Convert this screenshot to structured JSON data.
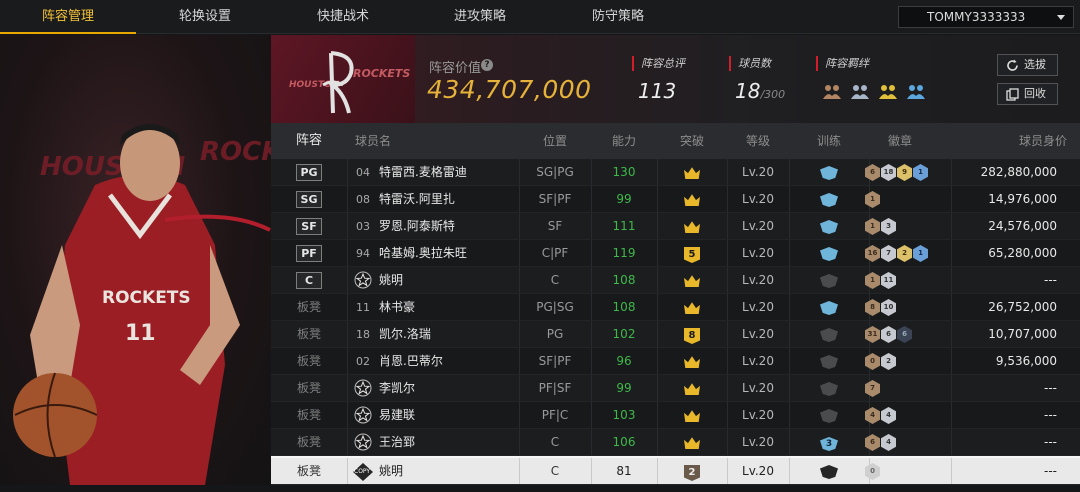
{
  "nav": {
    "tabs": [
      "阵容管理",
      "轮换设置",
      "快捷战术",
      "进攻策略",
      "防守策略"
    ],
    "active_tab": 0,
    "user": "TOMMY3333333"
  },
  "team": {
    "logo_text_left": "HOUSTON",
    "logo_text_right": "ROCKETS",
    "art_text_left": "HOUSTON",
    "art_text_right": "ROCK",
    "jersey_team": "ROCKETS",
    "jersey_number": "11",
    "value_label": "阵容价值",
    "value": "434,707,000",
    "rating_label": "阵容总评",
    "rating": "113",
    "players_label": "球员数",
    "players": "18",
    "players_max": "/300",
    "chem_label": "阵容羁绊",
    "btn_pick": "选拔",
    "btn_recycle": "回收"
  },
  "columns": [
    "阵容",
    "球员名",
    "位置",
    "能力",
    "突破",
    "等级",
    "训练",
    "徽章",
    "球员身价"
  ],
  "colors": {
    "accent_gold": "#e7b23a",
    "ability_green": "#3fb84a",
    "label_red": "#d21e2b"
  },
  "rows": [
    {
      "slot": "PG",
      "starter": true,
      "num": "04",
      "name": "特雷西.麦格雷迪",
      "pos": "SG|PG",
      "ability": "130",
      "break": "crown",
      "level": "Lv.20",
      "train": "blue",
      "badges": [
        [
          "bronze",
          "6"
        ],
        [
          "silver",
          "18"
        ],
        [
          "gold",
          "9"
        ],
        [
          "blue",
          "1"
        ]
      ],
      "value": "282,880,000"
    },
    {
      "slot": "SG",
      "starter": true,
      "num": "08",
      "name": "特雷沃.阿里扎",
      "pos": "SF|PF",
      "ability": "99",
      "break": "crown",
      "level": "Lv.20",
      "train": "blue",
      "badges": [
        [
          "bronze",
          "1"
        ]
      ],
      "value": "14,976,000"
    },
    {
      "slot": "SF",
      "starter": true,
      "num": "03",
      "name": "罗恩.阿泰斯特",
      "pos": "SF",
      "ability": "111",
      "break": "crown",
      "level": "Lv.20",
      "train": "blue",
      "badges": [
        [
          "bronze",
          "1"
        ],
        [
          "silver",
          "3"
        ]
      ],
      "value": "24,576,000"
    },
    {
      "slot": "PF",
      "starter": true,
      "num": "94",
      "name": "哈基姆.奥拉朱旺",
      "pos": "C|PF",
      "ability": "119",
      "break": "5",
      "level": "Lv.20",
      "train": "blue",
      "badges": [
        [
          "bronze",
          "16"
        ],
        [
          "silver",
          "7"
        ],
        [
          "gold",
          "2"
        ],
        [
          "blue",
          "1"
        ]
      ],
      "value": "65,280,000"
    },
    {
      "slot": "C",
      "starter": true,
      "num": "",
      "star": true,
      "name": "姚明",
      "pos": "C",
      "ability": "108",
      "break": "crown",
      "level": "Lv.20",
      "train": "gray",
      "badges": [
        [
          "bronze",
          "1"
        ],
        [
          "silver",
          "11"
        ]
      ],
      "value": "---"
    },
    {
      "slot": "板凳",
      "starter": false,
      "num": "11",
      "name": "林书豪",
      "pos": "PG|SG",
      "ability": "108",
      "break": "crown",
      "level": "Lv.20",
      "train": "blue",
      "badges": [
        [
          "bronze",
          "8"
        ],
        [
          "silver",
          "10"
        ]
      ],
      "value": "26,752,000"
    },
    {
      "slot": "板凳",
      "starter": false,
      "num": "18",
      "name": "凯尔.洛瑞",
      "pos": "PG",
      "ability": "102",
      "break": "8",
      "level": "Lv.20",
      "train": "gray",
      "badges": [
        [
          "bronze",
          "31"
        ],
        [
          "silver",
          "6"
        ],
        [
          "dark",
          "6"
        ]
      ],
      "value": "10,707,000"
    },
    {
      "slot": "板凳",
      "starter": false,
      "num": "02",
      "name": "肖恩.巴蒂尔",
      "pos": "SF|PF",
      "ability": "96",
      "break": "crown",
      "level": "Lv.20",
      "train": "gray",
      "badges": [
        [
          "bronze",
          "0"
        ],
        [
          "silver",
          "2"
        ]
      ],
      "value": "9,536,000"
    },
    {
      "slot": "板凳",
      "starter": false,
      "num": "",
      "star": true,
      "name": "李凯尔",
      "pos": "PF|SF",
      "ability": "99",
      "break": "crown",
      "level": "Lv.20",
      "train": "gray",
      "badges": [
        [
          "bronze",
          "7"
        ]
      ],
      "value": "---"
    },
    {
      "slot": "板凳",
      "starter": false,
      "num": "",
      "star": true,
      "name": "易建联",
      "pos": "PF|C",
      "ability": "103",
      "break": "crown",
      "level": "Lv.20",
      "train": "gray",
      "badges": [
        [
          "bronze",
          "4"
        ],
        [
          "silver",
          "4"
        ]
      ],
      "value": "---"
    },
    {
      "slot": "板凳",
      "starter": false,
      "num": "",
      "star": true,
      "name": "王治郅",
      "pos": "C",
      "ability": "106",
      "break": "crown",
      "level": "Lv.20",
      "train": "blue3",
      "badges": [
        [
          "bronze",
          "6"
        ],
        [
          "silver",
          "4"
        ]
      ],
      "value": "---"
    },
    {
      "slot": "板凳",
      "starter": false,
      "num": "",
      "copy": true,
      "name": "姚明",
      "pos": "C",
      "ability": "81",
      "break": "2",
      "level": "Lv.20",
      "train": "dark",
      "badges": [
        [
          "none",
          "0"
        ]
      ],
      "value": "---",
      "selected": true
    }
  ],
  "copy_label": "COPY",
  "train3_label": "3"
}
